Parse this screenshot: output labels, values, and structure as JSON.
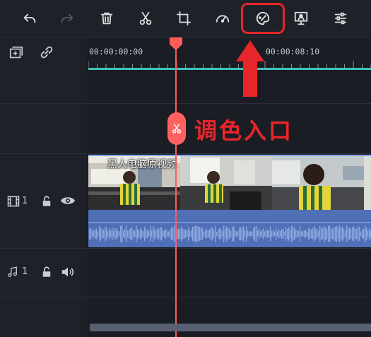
{
  "toolbar": {
    "buttons": [
      {
        "name": "undo",
        "icon": "undo-icon"
      },
      {
        "name": "redo",
        "icon": "redo-icon"
      },
      {
        "name": "delete",
        "icon": "trash-icon"
      },
      {
        "name": "split",
        "icon": "scissors-icon"
      },
      {
        "name": "crop",
        "icon": "crop-icon"
      },
      {
        "name": "speed",
        "icon": "speedometer-icon"
      },
      {
        "name": "color",
        "icon": "palette-icon"
      },
      {
        "name": "green-screen",
        "icon": "presenter-icon"
      },
      {
        "name": "adjust",
        "icon": "sliders-icon"
      }
    ]
  },
  "timeline": {
    "ruler": {
      "timecode_start": "00:00:00:00",
      "timecode_mid": "00:00:08:10"
    },
    "video_track": {
      "number": "1",
      "clip_title": "黑人电脑原视频"
    },
    "audio_track": {
      "number": "1"
    }
  },
  "annotation": {
    "text": "调色入口",
    "color": "#e6262a"
  },
  "colors": {
    "playhead": "#ff5b5b",
    "ruler_line": "#3ec4bb",
    "clip_blue": "#4e6db0"
  }
}
